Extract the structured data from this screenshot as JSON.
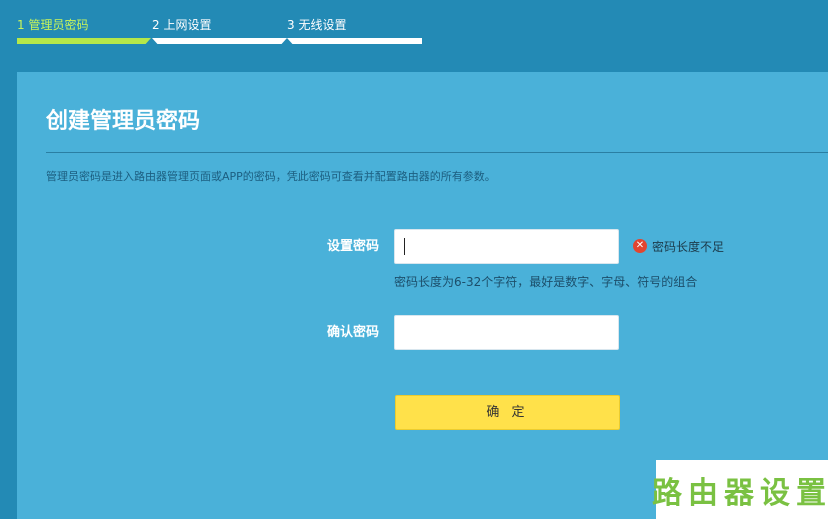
{
  "steps": [
    {
      "number": "1",
      "label": "1 管理员密码",
      "active": true
    },
    {
      "number": "2",
      "label": "2 上网设置",
      "active": false
    },
    {
      "number": "3",
      "label": "3 无线设置",
      "active": false
    }
  ],
  "page": {
    "title": "创建管理员密码",
    "description": "管理员密码是进入路由器管理页面或APP的密码，凭此密码可查看并配置路由器的所有参数。"
  },
  "form": {
    "password_label": "设置密码",
    "password_value": "",
    "error_text": "密码长度不足",
    "hint_text": "密码长度为6-32个字符，最好是数字、字母、符号的组合",
    "confirm_label": "确认密码",
    "confirm_value": "",
    "submit_label": "确 定"
  },
  "watermark": {
    "text": "路由器设置"
  },
  "colors": {
    "background": "#238ab5",
    "panel": "#4ab1d9",
    "active_step": "#b5e84a",
    "button": "#ffe14a",
    "error_icon": "#e2452f",
    "watermark": "#7ac142"
  }
}
